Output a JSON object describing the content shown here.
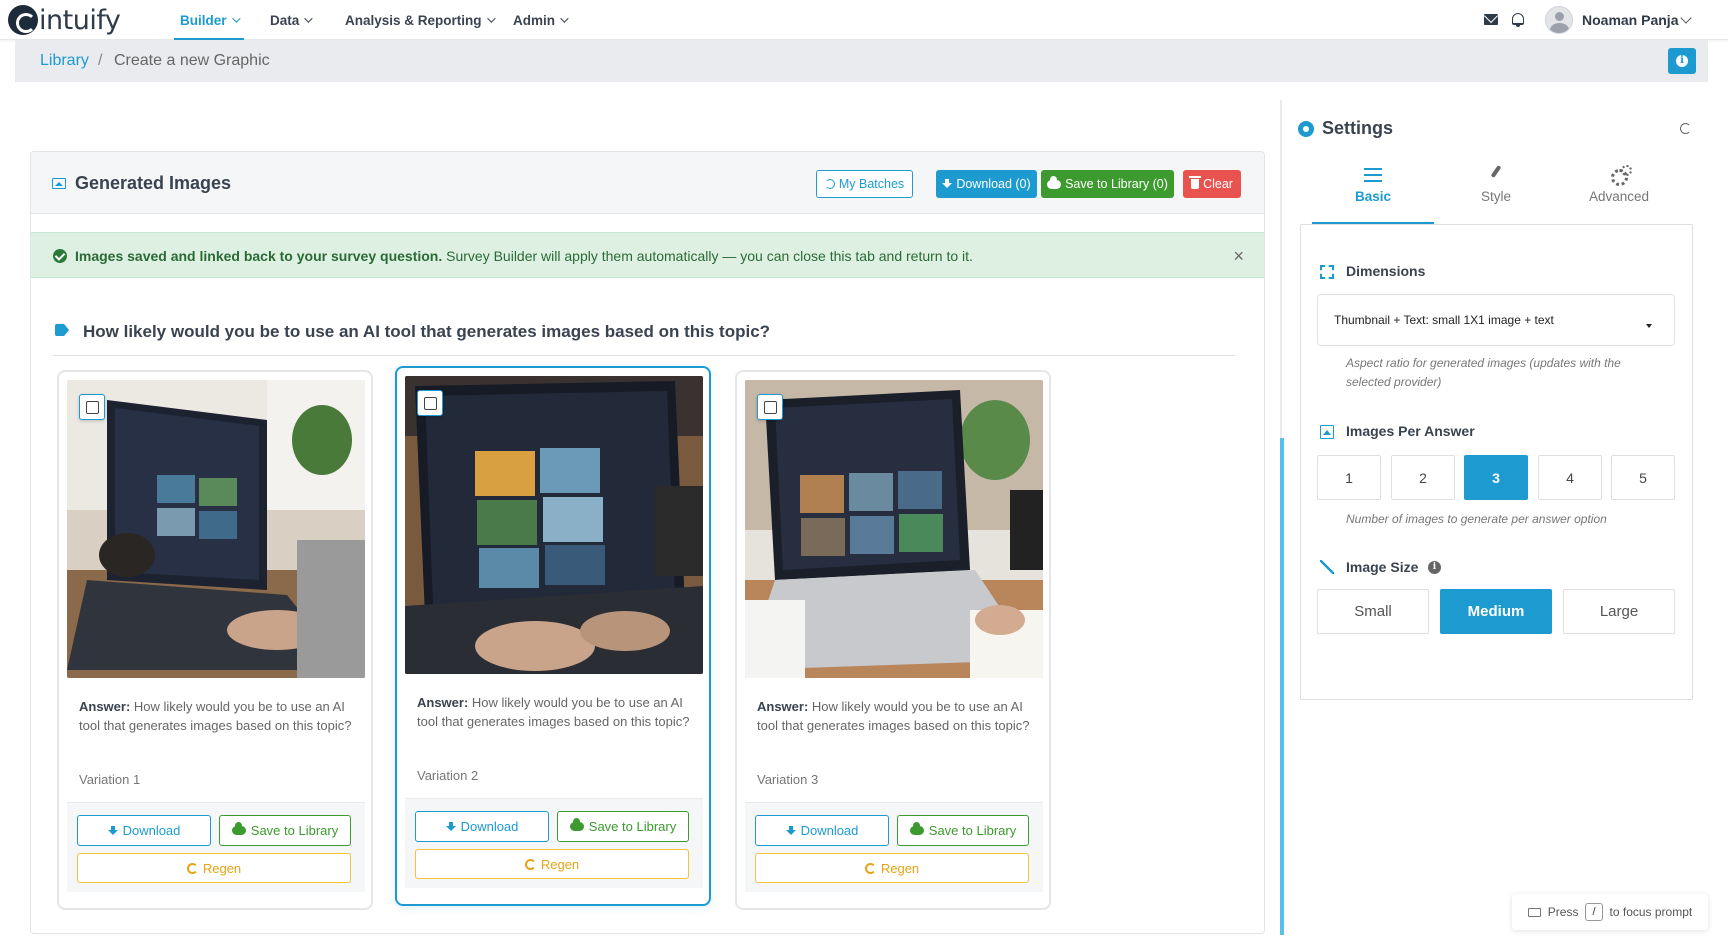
{
  "app": {
    "logo_text": "intuify"
  },
  "nav": {
    "items": [
      {
        "label": "Builder",
        "active": true
      },
      {
        "label": "Data",
        "active": false
      },
      {
        "label": "Analysis & Reporting",
        "active": false
      },
      {
        "label": "Admin",
        "active": false
      }
    ],
    "user_name": "Noaman Panja"
  },
  "breadcrumb": {
    "library": "Library",
    "separator": "/",
    "current": "Create a new Graphic"
  },
  "panel": {
    "title": "Generated Images",
    "my_batches": "My Batches",
    "download": "Download (0)",
    "save_to_library": "Save to Library (0)",
    "clear": "Clear"
  },
  "alert": {
    "bold": "Images saved and linked back to your survey question.",
    "rest": " Survey Builder will apply them automatically — you can close this tab and return to it.",
    "close": "×"
  },
  "question": "How likely would you be to use an AI tool that generates images based on this topic?",
  "cards": [
    {
      "answer_label": "Answer:",
      "answer_text": " How likely would you be to use an AI tool that generates images based on this topic?",
      "variation": "Variation 1",
      "download": "Download",
      "save": "Save to Library",
      "regen": "Regen",
      "selected": false
    },
    {
      "answer_label": "Answer:",
      "answer_text": " How likely would you be to use an AI tool that generates images based on this topic?",
      "variation": "Variation 2",
      "download": "Download",
      "save": "Save to Library",
      "regen": "Regen",
      "selected": true
    },
    {
      "answer_label": "Answer:",
      "answer_text": " How likely would you be to use an AI tool that generates images based on this topic?",
      "variation": "Variation 3",
      "download": "Download",
      "save": "Save to Library",
      "regen": "Regen",
      "selected": false
    }
  ],
  "settings": {
    "title": "Settings",
    "tabs": [
      {
        "label": "Basic",
        "active": true
      },
      {
        "label": "Style",
        "active": false
      },
      {
        "label": "Advanced",
        "active": false
      }
    ],
    "dimensions": {
      "label": "Dimensions",
      "value": "Thumbnail + Text: small 1X1 image + text",
      "help": "Aspect ratio for generated images (updates with the selected provider)"
    },
    "images_per_answer": {
      "label": "Images Per Answer",
      "options": [
        "1",
        "2",
        "3",
        "4",
        "5"
      ],
      "selected": "3",
      "help": "Number of images to generate per answer option"
    },
    "image_size": {
      "label": "Image Size",
      "info": "i",
      "options": [
        "Small",
        "Medium",
        "Large"
      ],
      "selected": "Medium"
    }
  },
  "hint": {
    "press": "Press",
    "key": "/",
    "rest": "to focus prompt"
  },
  "colors": {
    "accent": "#1d9bd1",
    "success": "#3d9a2f",
    "danger": "#e9534f",
    "warning": "#f2c33c"
  }
}
